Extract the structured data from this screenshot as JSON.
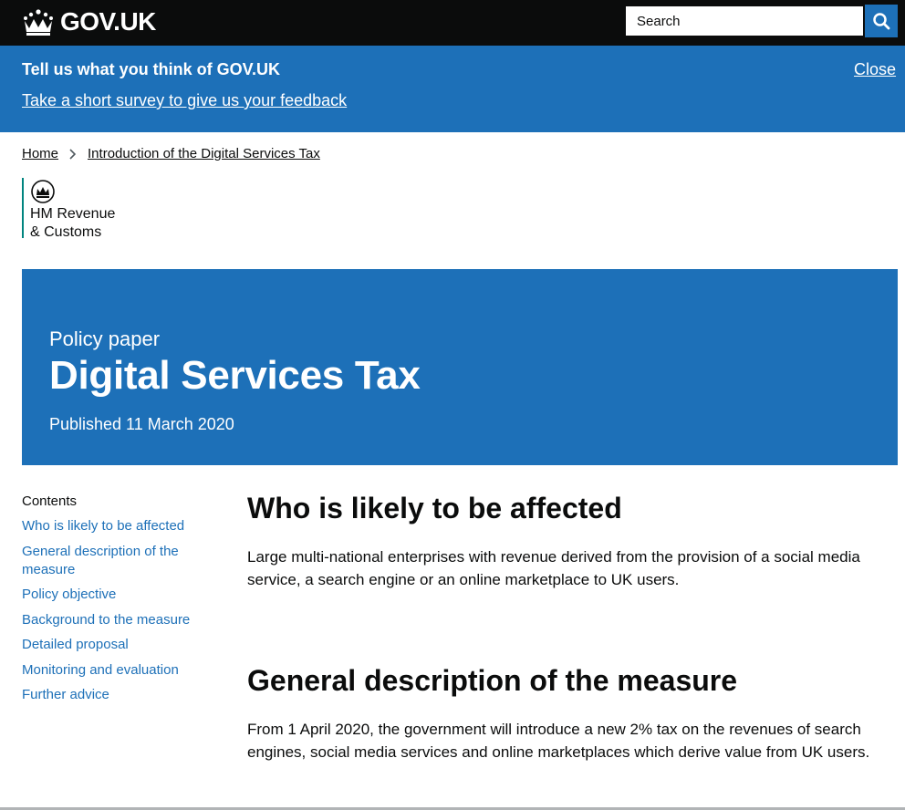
{
  "header": {
    "logo_text": "GOV.UK",
    "search_placeholder": "Search"
  },
  "survey": {
    "title": "Tell us what you think of GOV.UK",
    "link": "Take a short survey to give us your feedback",
    "close": "Close"
  },
  "breadcrumb": {
    "items": [
      "Home",
      "Introduction of the Digital Services Tax"
    ]
  },
  "organisation": {
    "line1": "HM Revenue",
    "line2": "& Customs"
  },
  "hero": {
    "caption": "Policy paper",
    "title": "Digital Services Tax",
    "published": "Published 11 March 2020"
  },
  "contents": {
    "heading": "Contents",
    "items": [
      "Who is likely to be affected",
      "General description of the measure",
      "Policy objective",
      "Background to the measure",
      "Detailed proposal",
      "Monitoring and evaluation",
      "Further advice"
    ]
  },
  "sections": [
    {
      "heading": "Who is likely to be affected",
      "body": "Large multi-national enterprises with revenue derived from the provision of a social media service, a search engine or an online marketplace to UK users."
    },
    {
      "heading": "General description of the measure",
      "body": "From 1 April 2020, the government will introduce a new 2% tax on the revenues of search engines, social media services and online marketplaces which derive value from UK users."
    }
  ],
  "colors": {
    "brand_blue": "#1d70b8",
    "header_black": "#0b0c0c",
    "org_stripe": "#00847f"
  }
}
